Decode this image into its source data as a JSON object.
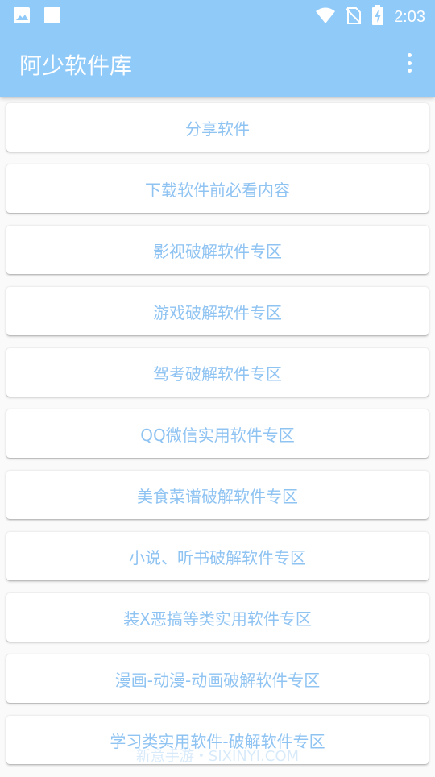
{
  "status_bar": {
    "time": "2:03",
    "left_icons": [
      "image-icon",
      "square-icon"
    ],
    "right_icons": [
      "wifi-icon",
      "no-sim-icon",
      "battery-charging-icon"
    ]
  },
  "app_bar": {
    "title": "阿少软件库",
    "overflow_icon": "more-vert-icon",
    "background_color": "#90caf9"
  },
  "items": [
    {
      "label": "分享软件"
    },
    {
      "label": "下载软件前必看内容"
    },
    {
      "label": "影视破解软件专区"
    },
    {
      "label": "游戏破解软件专区"
    },
    {
      "label": "驾考破解软件专区"
    },
    {
      "label": "QQ微信实用软件专区"
    },
    {
      "label": "美食菜谱破解软件专区"
    },
    {
      "label": "小说、听书破解软件专区"
    },
    {
      "label": "装X恶搞等类实用软件专区"
    },
    {
      "label": "漫画-动漫-动画破解软件专区"
    },
    {
      "label": "学习类实用软件-破解软件专区"
    }
  ],
  "watermark": "新意手游・SIXINYI.COM",
  "colors": {
    "accent": "#90caf9",
    "item_text": "#8fc3f2",
    "background": "#fafafa"
  }
}
